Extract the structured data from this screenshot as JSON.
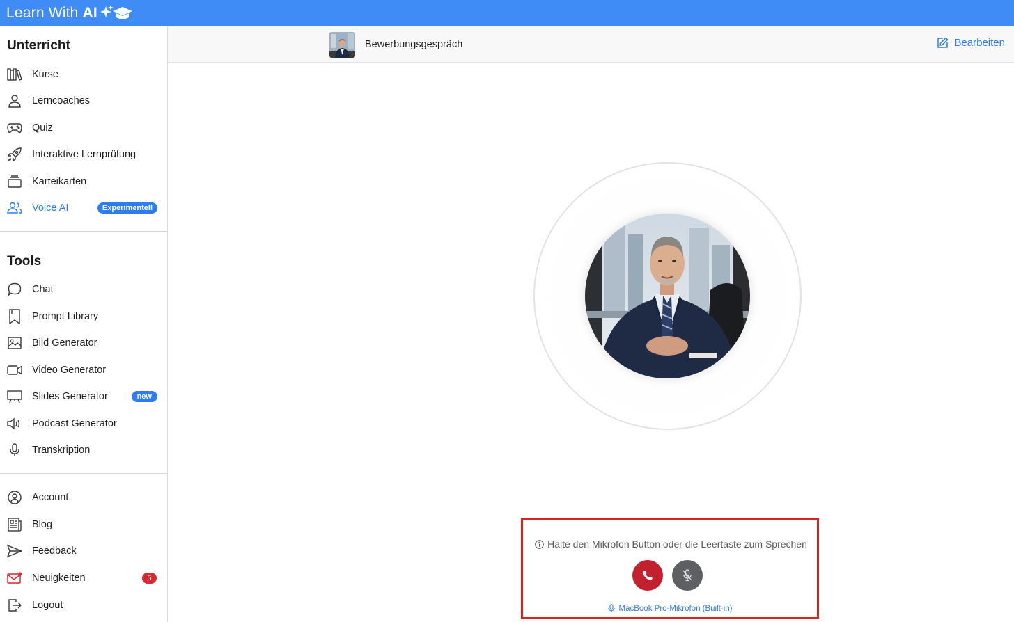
{
  "brand": {
    "name_regular": "Learn With",
    "name_bold": "AI"
  },
  "sidebar": {
    "section_teaching": "Unterricht",
    "teaching_items": [
      {
        "label": "Kurse",
        "icon": "books-icon"
      },
      {
        "label": "Lerncoaches",
        "icon": "person-icon"
      },
      {
        "label": "Quiz",
        "icon": "gamepad-icon"
      },
      {
        "label": "Interaktive Lernprüfung",
        "icon": "rocket-icon"
      },
      {
        "label": "Karteikarten",
        "icon": "cards-icon"
      },
      {
        "label": "Voice AI",
        "icon": "users-icon",
        "badge": "Experimentell",
        "active": true
      }
    ],
    "section_tools": "Tools",
    "tool_items": [
      {
        "label": "Chat",
        "icon": "chat-bubble-icon"
      },
      {
        "label": "Prompt Library",
        "icon": "bookmark-icon"
      },
      {
        "label": "Bild Generator",
        "icon": "image-icon"
      },
      {
        "label": "Video Generator",
        "icon": "video-camera-icon"
      },
      {
        "label": "Slides Generator",
        "icon": "presentation-icon",
        "badge": "new"
      },
      {
        "label": "Podcast Generator",
        "icon": "speaker-icon"
      },
      {
        "label": "Transkription",
        "icon": "microphone-icon"
      }
    ],
    "account_items": [
      {
        "label": "Account",
        "icon": "user-circle-icon"
      },
      {
        "label": "Blog",
        "icon": "newspaper-icon"
      },
      {
        "label": "Feedback",
        "icon": "send-icon"
      },
      {
        "label": "Neuigkeiten",
        "icon": "mail-icon",
        "count": "5"
      },
      {
        "label": "Logout",
        "icon": "logout-icon"
      }
    ]
  },
  "subheader": {
    "title": "Bewerbungsgespräch",
    "edit_label": "Bearbeiten"
  },
  "call": {
    "hint": "Halte den Mikrofon Button oder die Leertaste zum Sprechen",
    "mic_device": "MacBook Pro-Mikrofon (Built-in)"
  },
  "colors": {
    "brand": "#3f8cf6",
    "accent": "#2f7cf0",
    "hangup": "#c2202e",
    "mic_button": "#5d5f63",
    "highlight_border": "#d8231f"
  }
}
